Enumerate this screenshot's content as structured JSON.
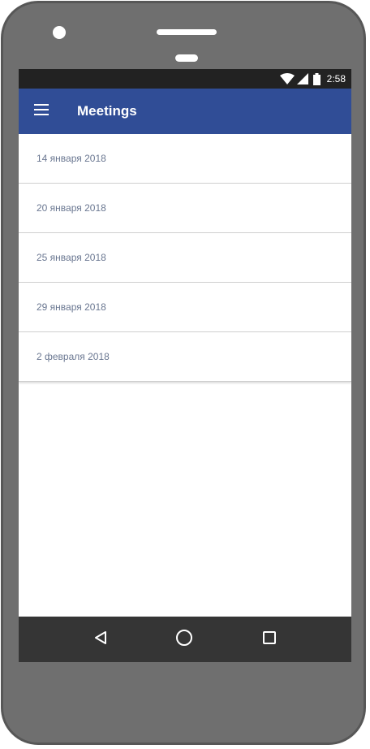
{
  "status_bar": {
    "time": "2:58",
    "icons": [
      "wifi-icon",
      "signal-icon",
      "battery-icon"
    ]
  },
  "app_bar": {
    "title": "Meetings",
    "menu_icon": "menu-icon",
    "color": "#304d96"
  },
  "meetings": [
    {
      "date": "14 января 2018"
    },
    {
      "date": "20 января 2018"
    },
    {
      "date": "25 января 2018"
    },
    {
      "date": "29 января 2018"
    },
    {
      "date": "2 февраля 2018"
    }
  ],
  "nav_bar": {
    "buttons": [
      "back-icon",
      "home-icon",
      "recents-icon"
    ]
  },
  "colors": {
    "phone_body": "#6f6f6f",
    "status_bar": "#222222",
    "nav_bar": "#353535",
    "list_text": "#6a7791"
  }
}
